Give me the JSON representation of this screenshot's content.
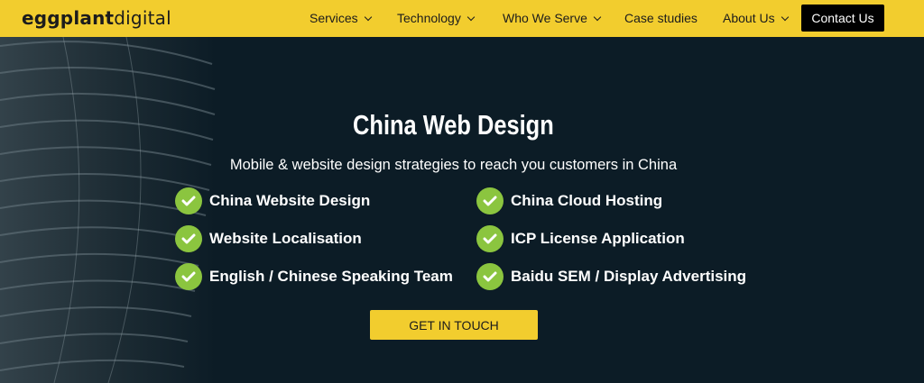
{
  "header": {
    "logo_bold": "eggplant",
    "logo_light": "digital",
    "nav": [
      {
        "label": "Services",
        "has_dropdown": true
      },
      {
        "label": "Technology",
        "has_dropdown": true
      },
      {
        "label": "Who We Serve",
        "has_dropdown": true
      },
      {
        "label": "Case studies",
        "has_dropdown": false
      },
      {
        "label": "About Us",
        "has_dropdown": true
      }
    ],
    "contact_label": "Contact Us"
  },
  "hero": {
    "title": "China Web Design",
    "subtitle": "Mobile & website design strategies to reach you customers in China",
    "features_left": [
      "China Website Design",
      "Website Localisation",
      "English / Chinese Speaking Team"
    ],
    "features_right": [
      "China Cloud Hosting",
      "ICP License Application",
      "Baidu SEM / Display Advertising"
    ],
    "cta_label": "GET IN TOUCH"
  },
  "colors": {
    "brand_yellow": "#f2cd2e",
    "hero_background": "#0c1c26",
    "check_green": "#8bc53f",
    "contact_button": "#000000"
  },
  "icons": {
    "nav_dropdown": "chevron-down-icon",
    "feature": "check-circle-icon"
  }
}
